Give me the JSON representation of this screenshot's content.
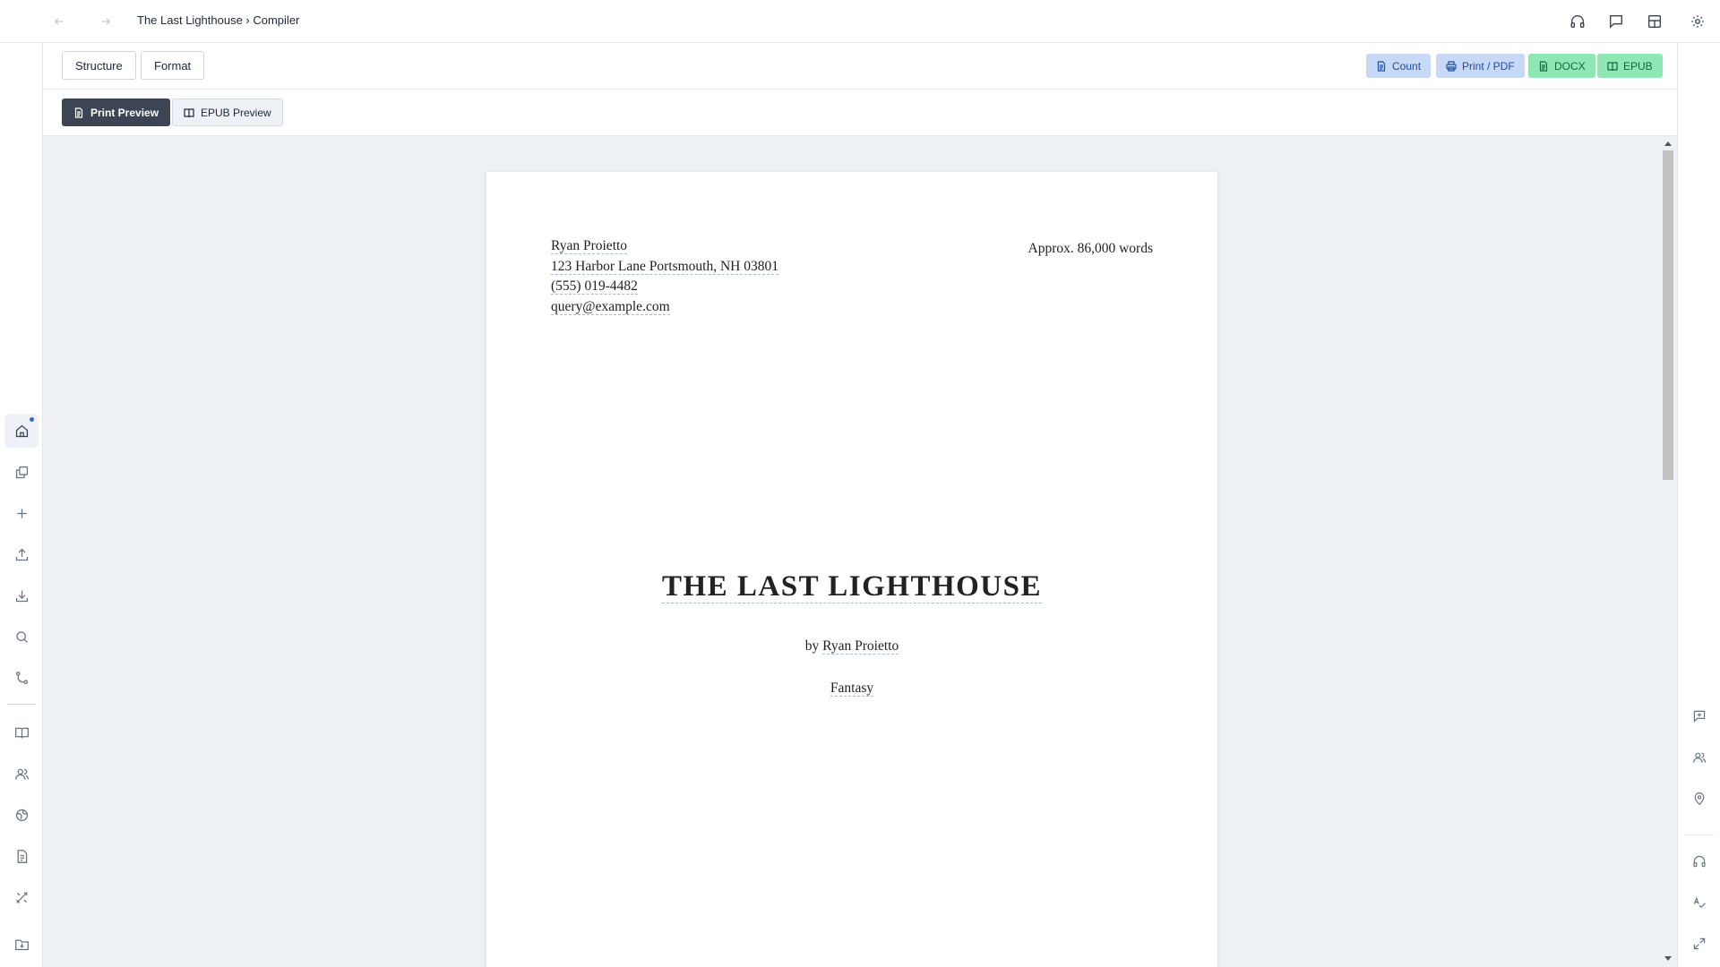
{
  "topbar": {
    "breadcrumb": "The Last Lighthouse › Compiler",
    "icons": [
      "back-arrow-icon",
      "forward-arrow-icon",
      "headphones-icon",
      "message-icon",
      "layout-icon",
      "gear-icon"
    ]
  },
  "toolbar": {
    "tabs": [
      {
        "label": "Structure"
      },
      {
        "label": "Format"
      }
    ],
    "actions": [
      {
        "label": "Count",
        "icon": "document-icon",
        "color": "#c7d9f7"
      },
      {
        "label": "Print / PDF",
        "icon": "printer-icon",
        "color": "#c7d9f7"
      },
      {
        "label": "DOCX",
        "icon": "document-icon",
        "color": "#8ee8b4"
      },
      {
        "label": "EPUB",
        "icon": "book-icon",
        "color": "#8ee8b4"
      }
    ]
  },
  "preview_modes": [
    {
      "label": "Print Preview",
      "icon": "document-icon",
      "selected": true
    },
    {
      "label": "EPUB Preview",
      "icon": "book-icon",
      "selected": false
    }
  ],
  "manuscript": {
    "author": "Ryan Proietto",
    "address": "123 Harbor Lane Portsmouth, NH 03801",
    "phone": "(555) 019-4482",
    "email": "query@example.com",
    "word_count": "Approx. 86,000 words",
    "title": "THE LAST LIGHTHOUSE",
    "by_prefix": "by",
    "byline_author": "Ryan Proietto",
    "genre": "Fantasy"
  },
  "left_rail": [
    "home-icon",
    "copy-icon",
    "plus-icon",
    "upload-icon",
    "download-icon",
    "search-icon",
    "branch-icon",
    "book-icon",
    "users-icon",
    "globe-icon",
    "file-text-icon",
    "tools-icon",
    "folder-download-icon"
  ],
  "right_rail": [
    "comment-plus-icon",
    "users-icon",
    "map-pin-icon",
    "headphones-icon",
    "spell-check-icon",
    "expand-icon"
  ],
  "colors": {
    "accent": "#3b63d6",
    "selected_tab": "#3d4453",
    "preview_bg": "#edf1f5"
  }
}
